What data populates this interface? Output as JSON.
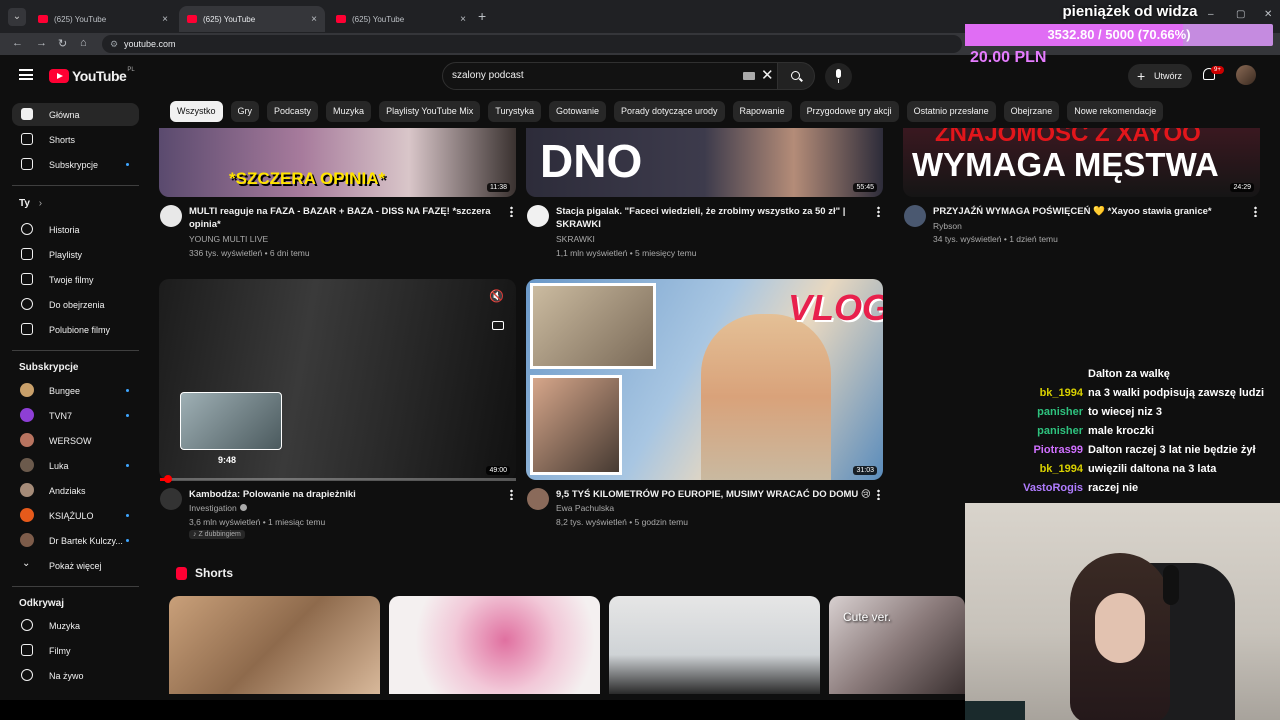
{
  "browser": {
    "tabs": [
      {
        "title": "(625) YouTube",
        "active": false
      },
      {
        "title": "(625) YouTube",
        "active": true
      },
      {
        "title": "(625) YouTube",
        "active": false
      }
    ],
    "new_tab": "+",
    "close_glyph": "×",
    "url": "youtube.com",
    "window_controls": [
      "–",
      "▢",
      "✕"
    ]
  },
  "header": {
    "logo_text": "YouTube",
    "logo_country": "PL",
    "search_value": "szalony podcast",
    "search_clear": "✕",
    "create_label": "Utwórz",
    "create_plus": "+",
    "notifications_badge": "9+"
  },
  "chips": [
    "Wszystko",
    "Gry",
    "Podcasty",
    "Muzyka",
    "Playlisty YouTube Mix",
    "Turystyka",
    "Gotowanie",
    "Porady dotyczące urody",
    "Rapowanie",
    "Przygodowe gry akcji",
    "Ostatnio przesłane",
    "Obejrzane",
    "Nowe rekomendacje"
  ],
  "sidebar": {
    "main": [
      {
        "label": "Główna",
        "icon": "home-icon"
      },
      {
        "label": "Shorts",
        "icon": "shorts-icon"
      },
      {
        "label": "Subskrypcje",
        "icon": "subscriptions-icon"
      }
    ],
    "you_heading": "Ty",
    "you_arrow": "›",
    "you": [
      {
        "label": "Historia",
        "icon": "history-icon"
      },
      {
        "label": "Playlisty",
        "icon": "playlist-icon"
      },
      {
        "label": "Twoje filmy",
        "icon": "your-videos-icon"
      },
      {
        "label": "Do obejrzenia",
        "icon": "watch-later-icon"
      },
      {
        "label": "Polubione filmy",
        "icon": "like-icon"
      }
    ],
    "subs_heading": "Subskrypcje",
    "subs": [
      {
        "label": "Bungee",
        "color": "#c9a06a"
      },
      {
        "label": "TVN7",
        "color": "#8e3fd6"
      },
      {
        "label": "WERSOW",
        "color": "#b87460"
      },
      {
        "label": "Luka",
        "color": "#6b5a4c"
      },
      {
        "label": "Andziaks",
        "color": "#a58b78"
      },
      {
        "label": "KSIĄŻULO",
        "color": "#e65a1b"
      },
      {
        "label": "Dr Bartek Kulczy...",
        "color": "#7d5c4a"
      }
    ],
    "show_more": "Pokaż więcej",
    "explore_heading": "Odkrywaj",
    "explore": [
      {
        "label": "Muzyka",
        "icon": "music-icon"
      },
      {
        "label": "Filmy",
        "icon": "movies-icon"
      },
      {
        "label": "Na żywo",
        "icon": "live-icon"
      }
    ]
  },
  "videos_row1": [
    {
      "title": "MULTI reaguje na FAZA - BAZAR + BAZA - DISS NA FAZĘ! *szczera opinia*",
      "channel": "YOUNG MULTI LIVE",
      "meta": "336 tys. wyświetleń • 6 dni temu",
      "duration": "11:38",
      "thumb_text": "*SZCZERA OPINIA*"
    },
    {
      "title": "Stacja pigalak. \"Faceci wiedzieli, że zrobimy wszystko za 50 zł\" | SKRAWKI",
      "channel": "SKRAWKI",
      "meta": "1,1 mln wyświetleń • 5 miesięcy temu",
      "duration": "55:45",
      "thumb_text": "DNO"
    },
    {
      "title": "PRZYJAŹŃ WYMAGA POŚWIĘCEŃ 💛 *Xayoo stawia granice*",
      "channel": "Rybson",
      "meta": "34 tys. wyświetleń • 1 dzień temu",
      "duration": "24:29",
      "thumb_text_top": "ZNAJOMOŚĆ Z XAYOO",
      "thumb_text": "WYMAGA MĘSTWA"
    }
  ],
  "videos_row2": [
    {
      "title": "Kambodża: Polowanie na drapieżniki",
      "channel": "Investigation",
      "meta": "3,6 mln wyświetleń • 1 miesiąc temu",
      "duration": "49:00",
      "dub": "Z dubbingiem",
      "preview_time": "9:48",
      "progress": 0.017
    },
    {
      "title": "9,5 TYŚ KILOMETRÓW PO EUROPIE, MUSIMY WRACAĆ DO DOMU 😢",
      "channel": "Ewa Pachulska",
      "meta": "8,2 tys. wyświetleń • 5 godzin temu",
      "duration": "31:03",
      "thumb_text": "VLOG"
    }
  ],
  "shorts": {
    "heading": "Shorts",
    "items": [
      {
        "caption": ""
      },
      {
        "caption": ""
      },
      {
        "caption": ""
      },
      {
        "caption": "Cute ver."
      }
    ]
  },
  "overlay": {
    "donation_title": "pieniążek od widza",
    "donation_progress": "3532.80 / 5000 (70.66%)",
    "donation_fraction": 0.7066,
    "donation_amount": "20.00 PLN",
    "chat": [
      {
        "user": "",
        "msg": "Dalton za walkę",
        "color": "#ffffff"
      },
      {
        "user": "bk_1994",
        "msg": "na 3 walki podpisują zawszę ludzi",
        "color": "#d8d000"
      },
      {
        "user": "panisher",
        "msg": "to wiecej niz 3",
        "color": "#2ec27e"
      },
      {
        "user": "panisher",
        "msg": "male kroczki",
        "color": "#2ec27e"
      },
      {
        "user": "Piotras99",
        "msg": "Dalton raczej 3 lat nie będzie żył",
        "color": "#d070ff"
      },
      {
        "user": "bk_1994",
        "msg": "uwięzili daltona na 3 lata",
        "color": "#d8d000"
      },
      {
        "user": "VastoRogis",
        "msg": "raczej nie",
        "color": "#b07cff"
      }
    ]
  }
}
